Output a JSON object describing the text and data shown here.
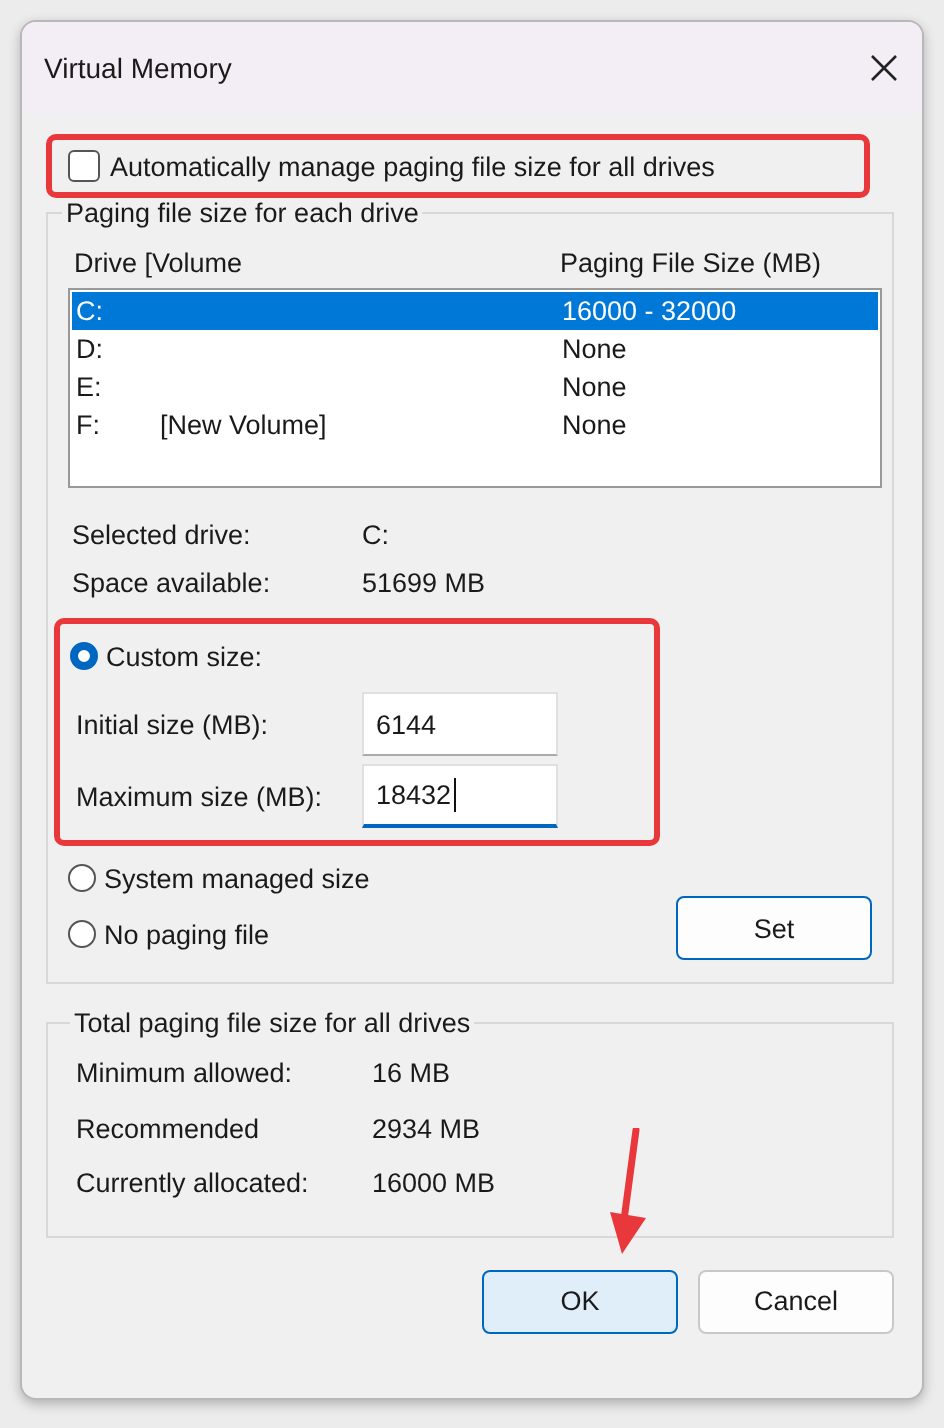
{
  "window": {
    "title": "Virtual Memory"
  },
  "auto_manage": {
    "label": "Automatically manage paging file size for all drives",
    "checked": false,
    "highlighted": true
  },
  "drives_group": {
    "title": "Paging file size for each drive",
    "columns": [
      "Drive  [Volume",
      "Paging File Size (MB)"
    ],
    "rows": [
      {
        "drive": "C:",
        "volume": "",
        "size": "16000 - 32000",
        "selected": true
      },
      {
        "drive": "D:",
        "volume": "",
        "size": "None",
        "selected": false
      },
      {
        "drive": "E:",
        "volume": "",
        "size": "None",
        "selected": false
      },
      {
        "drive": "F:",
        "volume": "[New Volume]",
        "size": "None",
        "selected": false
      }
    ],
    "info": [
      {
        "label": "Selected drive:",
        "value": "C:"
      },
      {
        "label": "Space available:",
        "value": "51699 MB"
      }
    ],
    "custom": {
      "label": "Custom size:",
      "selected": true,
      "highlighted": true,
      "fields": [
        {
          "label": "Initial size (MB):",
          "value": "6144",
          "focused": false
        },
        {
          "label": "Maximum size (MB):",
          "value": "18432",
          "focused": true
        }
      ]
    },
    "options": [
      {
        "label": "System managed size",
        "selected": false
      },
      {
        "label": "No paging file",
        "selected": false
      }
    ],
    "set_button": "Set"
  },
  "totals_group": {
    "title": "Total paging file size for all drives",
    "rows": [
      {
        "label": "Minimum allowed:",
        "value": "16 MB"
      },
      {
        "label": "Recommended",
        "value": "2934 MB"
      },
      {
        "label": "Currently allocated:",
        "value": "16000 MB"
      }
    ]
  },
  "buttons": [
    {
      "label": "OK",
      "default": true
    },
    {
      "label": "Cancel",
      "default": false
    }
  ],
  "annotations": [
    {
      "kind": "arrow"
    }
  ]
}
